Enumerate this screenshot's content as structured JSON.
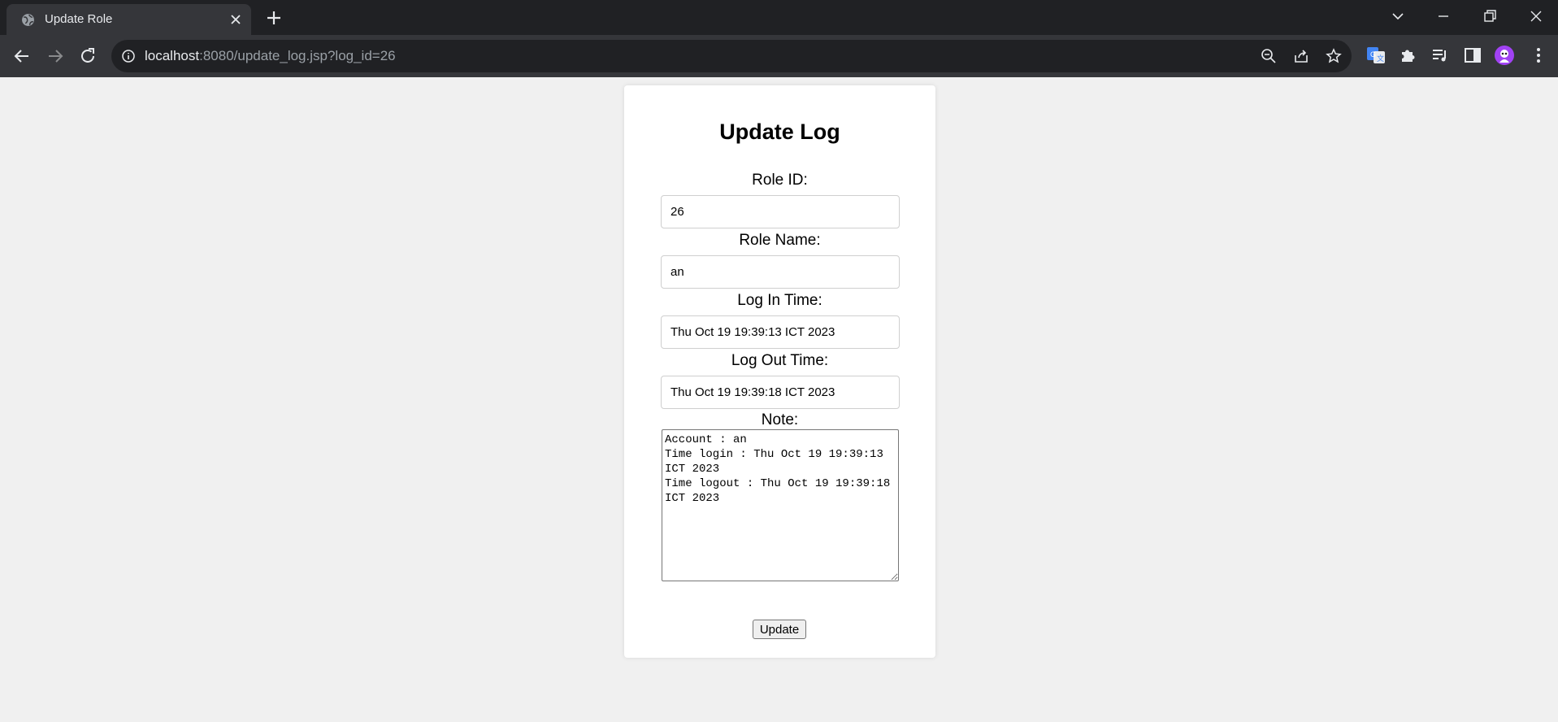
{
  "browser": {
    "tab_title": "Update Role",
    "url_host": "localhost",
    "url_rest": ":8080/update_log.jsp?log_id=26",
    "accent_color": "#8ab4f8",
    "profile_color": "#a142f4"
  },
  "form": {
    "title": "Update Log",
    "role_id_label": "Role ID:",
    "role_id_value": "26",
    "role_name_label": "Role Name:",
    "role_name_value": "an",
    "log_in_label": "Log In Time:",
    "log_in_value": "Thu Oct 19 19:39:13 ICT 2023",
    "log_out_label": "Log Out Time:",
    "log_out_value": "Thu Oct 19 19:39:18 ICT 2023",
    "note_label": "Note:",
    "note_value": "Account : an\nTime login : Thu Oct 19 19:39:13 ICT 2023\nTime logout : Thu Oct 19 19:39:18 ICT 2023",
    "submit_label": "Update"
  }
}
